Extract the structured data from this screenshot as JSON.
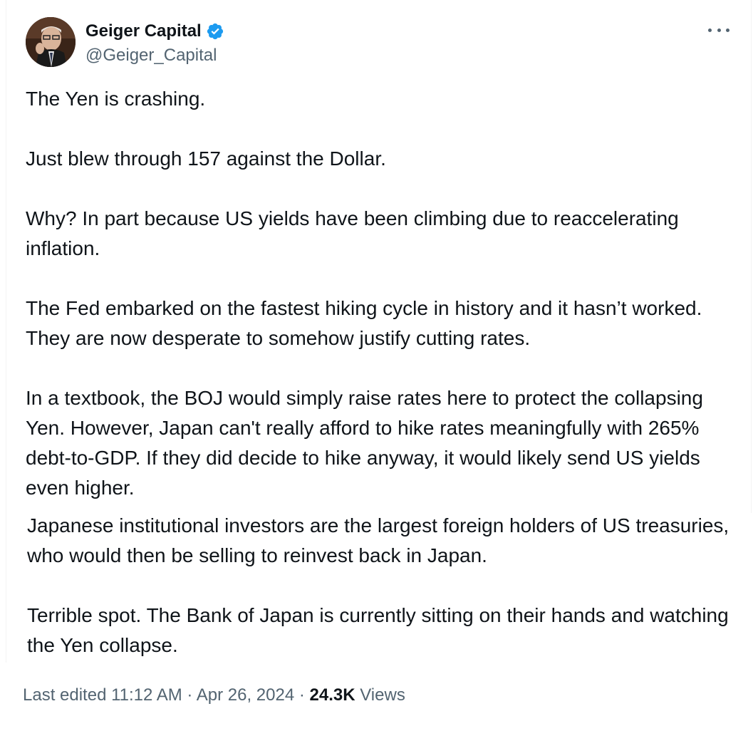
{
  "author": {
    "display_name": "Geiger Capital",
    "handle": "@Geiger_Capital",
    "verified_icon": "verified-badge-icon",
    "verified_color": "#1d9bf0"
  },
  "more_icon": "more-horizontal-icon",
  "tweet": {
    "paragraphs": [
      "The Yen is crashing.",
      "Just blew through 157 against the Dollar.",
      "Why? In part because US yields have been climbing due to reaccelerating inflation.",
      "The Fed embarked on the fastest hiking cycle in history and it hasn’t worked. They are now desperate to somehow justify cutting rates.",
      "In a textbook, the BOJ would simply raise rates here to protect the collapsing Yen. However, Japan can't really afford to hike rates meaningfully with 265% debt-to-GDP. If they did decide to hike anyway, it would likely send US yields even higher."
    ],
    "continuation": [
      "Japanese institutional investors are the largest foreign holders of US treasuries, who would then be selling to reinvest back in Japan.",
      "Terrible spot. The Bank of Japan is currently sitting on their hands and watching the Yen collapse."
    ]
  },
  "meta": {
    "edited_label": "Last edited",
    "time": "11:12 AM",
    "separator": "·",
    "date": "Apr 26, 2024",
    "views_count": "24.3K",
    "views_label": "Views"
  },
  "colors": {
    "text_primary": "#0f1419",
    "text_secondary": "#536471",
    "accent": "#1d9bf0"
  }
}
